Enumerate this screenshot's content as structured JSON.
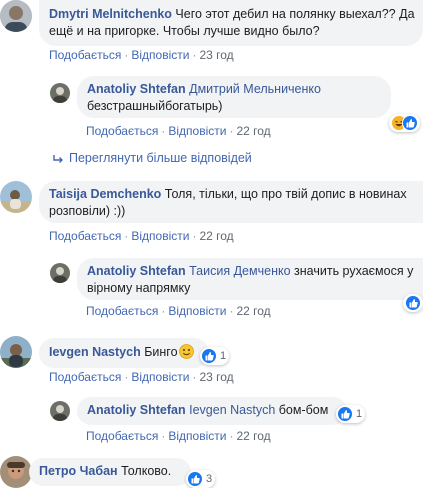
{
  "actions": {
    "like": "Подобається",
    "reply": "Відповісти"
  },
  "view_more": "Переглянути більше відповідей",
  "comments": [
    {
      "author": "Dmytri Melnitchenko",
      "line1": "Чего этот дебил на полянку выехал?? Да",
      "line2": "ещё и на пригорке. Чтобы лучше видно было?",
      "time": "23 год"
    },
    {
      "author": "Anatoliy Shtefan",
      "mention": "Дмитрий Мельниченко",
      "line1": "",
      "line2": "безстрашныйбогатырь)",
      "time": "22 год",
      "react_icon": "haha-icon"
    },
    {
      "author": "Taisija Demchenko",
      "line1": "Толя, тільки, що про твій допис в новинах",
      "line2": "розповіли) :))",
      "time": "22 год"
    },
    {
      "author": "Anatoliy Shtefan",
      "mention": "Таисия Демченко",
      "line1": "значить рухаємося у",
      "line2": "вірному напрямку",
      "time": "22 год",
      "react_icon": "like-icon"
    },
    {
      "author": "Ievgen Nastych",
      "text": "Бинго",
      "emoji": "slightly-smiling-face-icon",
      "time": "23 год",
      "react_icon": "like-icon",
      "react_count": "1"
    },
    {
      "author": "Anatoliy Shtefan",
      "mention": "Ievgen Nastych",
      "text": "бом-бом",
      "time": "22 год",
      "react_icon": "like-icon",
      "react_count": "1"
    },
    {
      "author": "Петро Чабан",
      "text": "Толково.",
      "react_icon": "like-icon",
      "react_count": "3"
    }
  ]
}
